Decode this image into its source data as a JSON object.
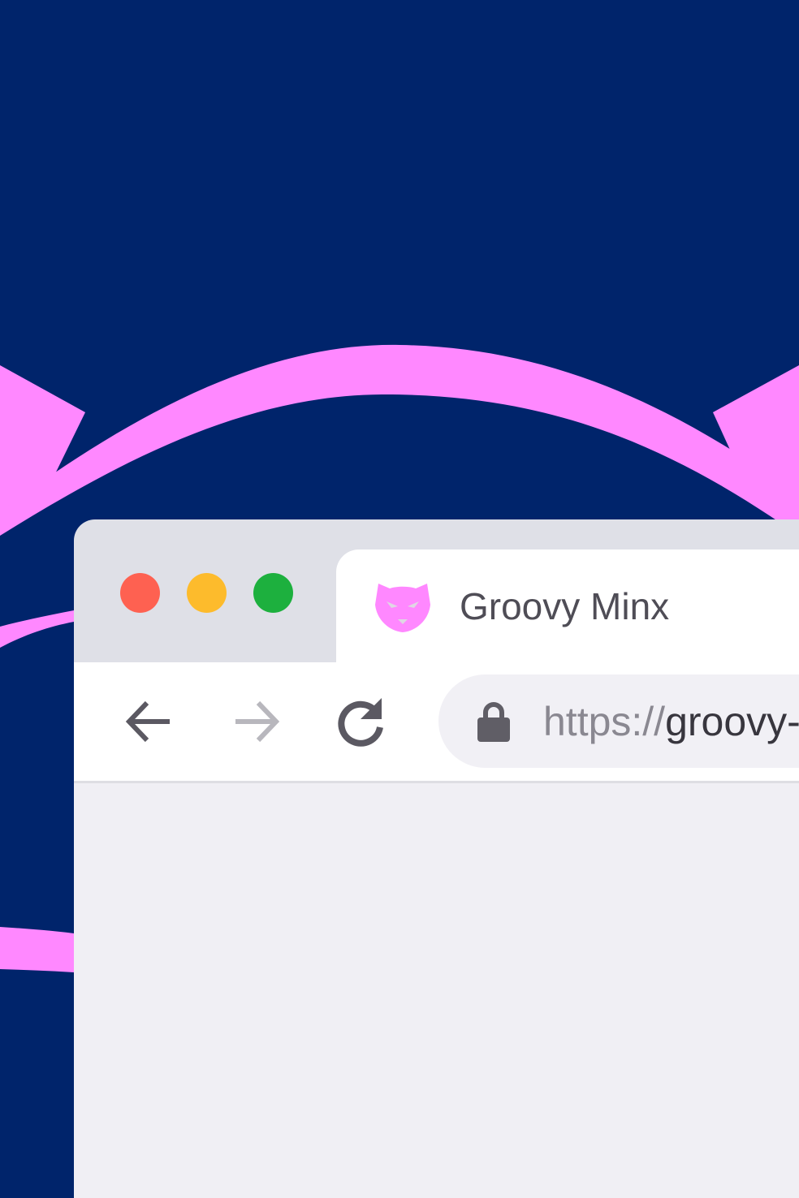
{
  "colors": {
    "background": "#00246b",
    "accent_pink": "#ff88ff",
    "close": "#fe6151",
    "minimize": "#fdbb2c",
    "maximize": "#1db03e"
  },
  "window_controls": {
    "close_icon": "close-traffic-light",
    "minimize_icon": "minimize-traffic-light",
    "maximize_icon": "maximize-traffic-light"
  },
  "tab": {
    "title": "Groovy Minx",
    "favicon": "groovy-minx-cat-icon"
  },
  "toolbar": {
    "back_icon": "arrow-left-icon",
    "forward_icon": "arrow-right-icon",
    "reload_icon": "reload-icon"
  },
  "address_bar": {
    "lock_icon": "lock-icon",
    "scheme": "https://",
    "host_visible": "groovy-"
  }
}
